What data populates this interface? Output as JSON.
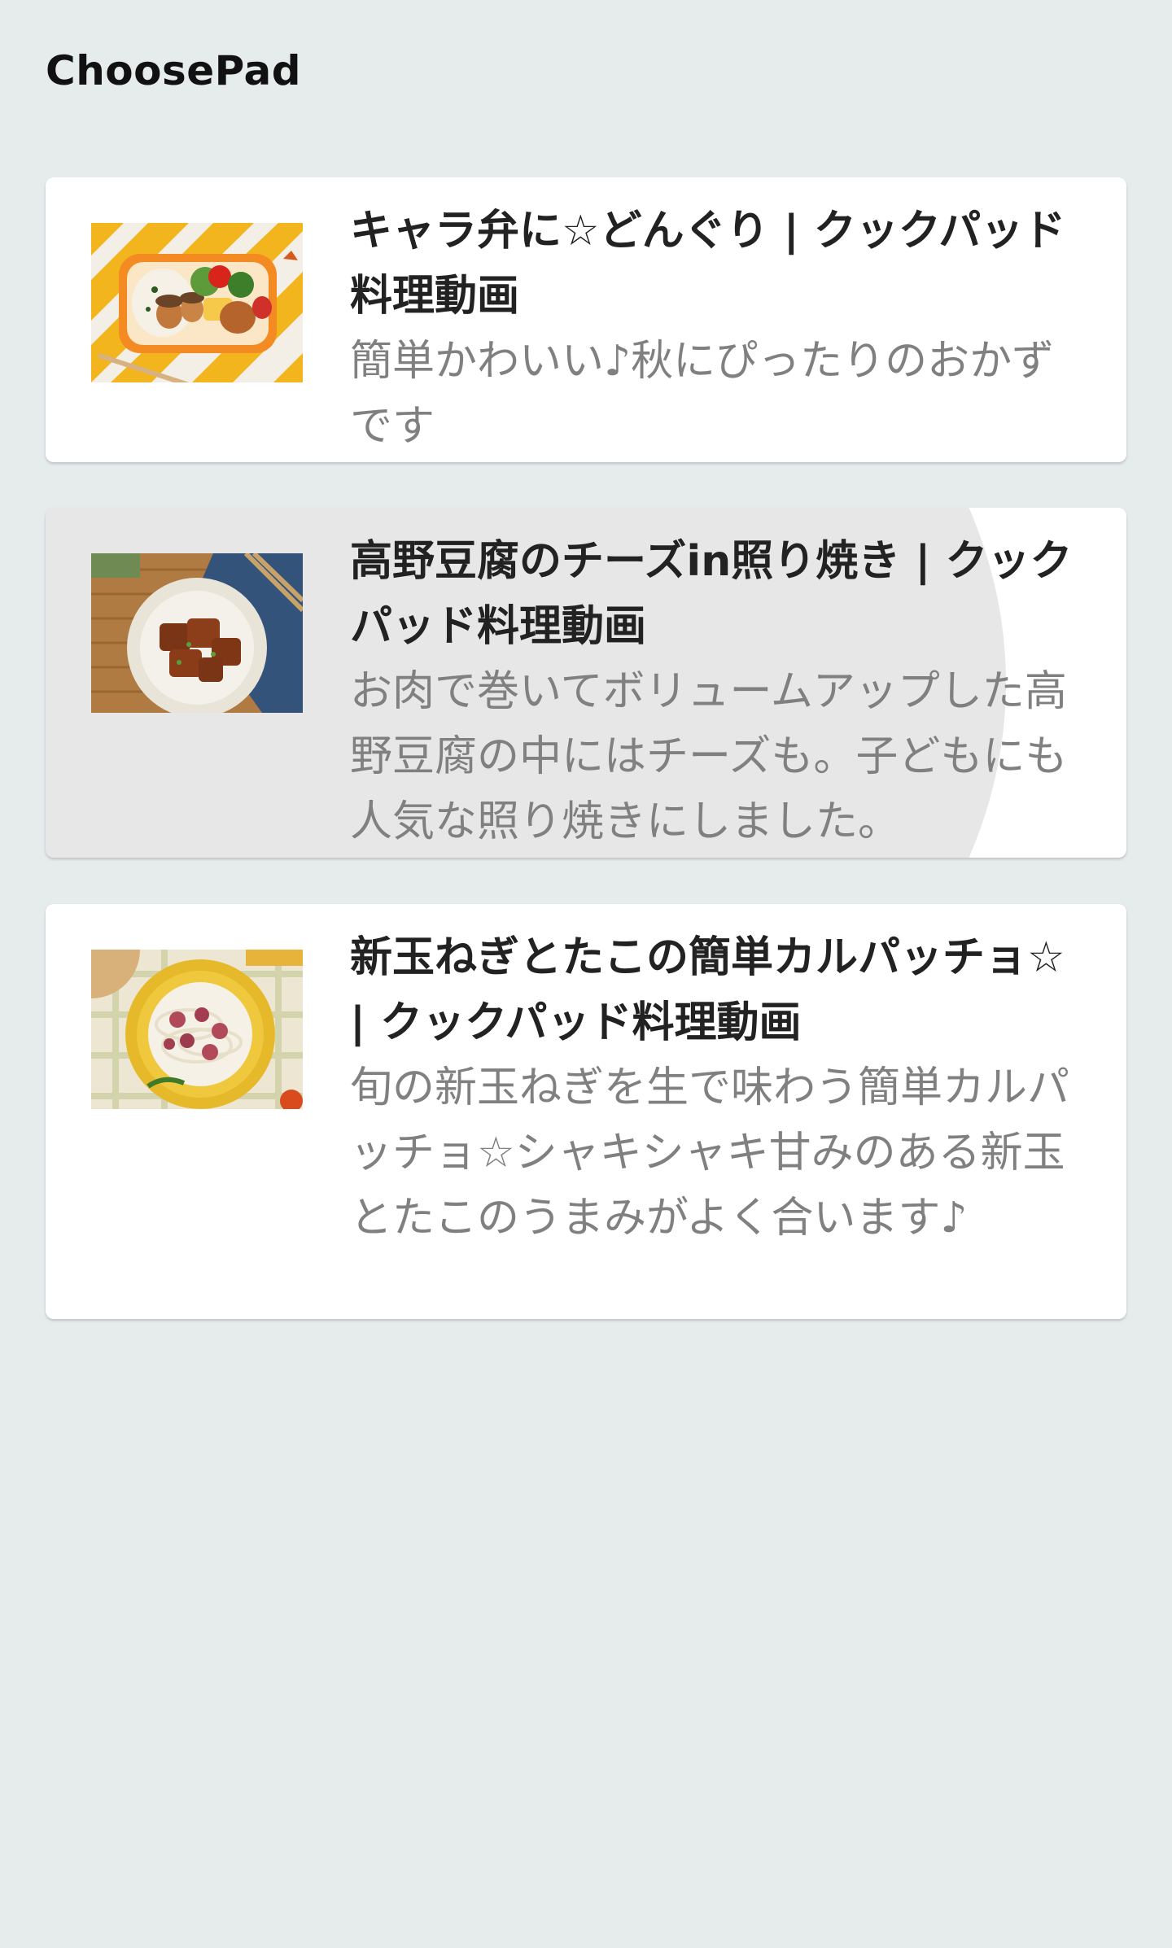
{
  "app": {
    "title": "ChoosePad"
  },
  "videos": [
    {
      "title": "キャラ弁に☆どんぐり | クックパッド料理動画",
      "description": "簡単かわいい♪秋にぴったりのおかずです",
      "thumbnail_icon": "bento-thumbnail"
    },
    {
      "title": "高野豆腐のチーズin照り焼き | クックパッド料理動画",
      "description": "お肉で巻いてボリュームアップした高野豆腐の中にはチーズも。子どもにも人気な照り焼きにしました。",
      "thumbnail_icon": "teriyaki-thumbnail"
    },
    {
      "title": "新玉ねぎとたこの簡単カルパッチョ☆ | クックパッド料理動画",
      "description": "旬の新玉ねぎを生で味わう簡単カルパッチョ☆シャキシャキ甘みのある新玉とたこのうまみがよく合います♪",
      "thumbnail_icon": "carpaccio-thumbnail"
    }
  ],
  "colors": {
    "background": "#e6ebec",
    "card": "#ffffff",
    "title_text": "#222222",
    "description_text": "#808080"
  }
}
